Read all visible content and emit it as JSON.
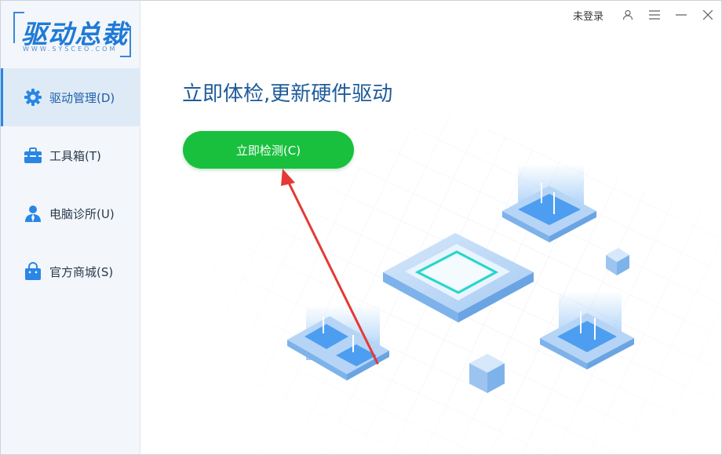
{
  "app": {
    "logo_text": "驱动总裁",
    "logo_sub": "WWW.SYSCEO.COM"
  },
  "topbar": {
    "login_label": "未登录",
    "icons": [
      "user-icon",
      "menu-icon",
      "minimize-icon",
      "close-icon"
    ]
  },
  "sidebar": {
    "items": [
      {
        "label": "驱动管理(D)",
        "icon": "gear-icon",
        "active": true
      },
      {
        "label": "工具箱(T)",
        "icon": "toolbox-icon",
        "active": false
      },
      {
        "label": "电脑诊所(U)",
        "icon": "doctor-icon",
        "active": false
      },
      {
        "label": "官方商城(S)",
        "icon": "shopping-bag-icon",
        "active": false
      }
    ]
  },
  "main": {
    "headline": "立即体检,更新硬件驱动",
    "detect_button": "立即检测(C)"
  },
  "colors": {
    "accent": "#1f7ad6",
    "button_green": "#19c03e",
    "headline": "#1f5c9a",
    "arrow": "#e53935"
  }
}
